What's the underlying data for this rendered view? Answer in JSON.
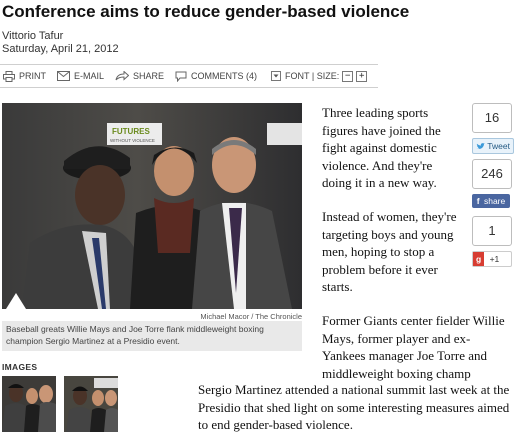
{
  "article": {
    "headline": "Conference aims to reduce gender-based violence",
    "author": "Vittorio Tafur",
    "date": "Saturday, April 21, 2012",
    "paragraph1": "Three leading sports figures have joined the fight against domestic violence. And they're doing it in a new way.",
    "paragraph2": "Instead of women, they're targeting boys and young men, hoping to stop a problem before it ever starts.",
    "paragraph3a": "Former Giants center fielder Willie Mays, former player and ex-Yankees manager Joe Torre and middleweight boxing champ",
    "paragraph3b": "Sergio Martinez attended a national summit last week at the Presidio that shed light on some interesting measures aimed to end gender-based violence."
  },
  "toolbar": {
    "print": "PRINT",
    "email": "E-MAIL",
    "share": "SHARE",
    "comments": "COMMENTS (4)",
    "font_label": "FONT | SIZE:",
    "decrease": "−",
    "increase": "+"
  },
  "photo": {
    "credit": "Michael Macor / The Chronicle",
    "caption": "Baseball greats Willie Mays and Joe Torre flank middleweight boxing champion Sergio Martinez at a Presidio event.",
    "banner_text": "FUTURES",
    "banner_subtext": "WITHOUT VIOLENCE"
  },
  "images_section": {
    "label": "IMAGES"
  },
  "social": {
    "twitter_count": "16",
    "twitter_label": "Tweet",
    "facebook_count": "246",
    "facebook_label": "share",
    "google_count": "1",
    "google_label": "+1",
    "google_icon": "g"
  },
  "colors": {
    "facebook": "#4a66a0",
    "twitter_bg": "#e8f2fa",
    "google": "#d73d32"
  }
}
